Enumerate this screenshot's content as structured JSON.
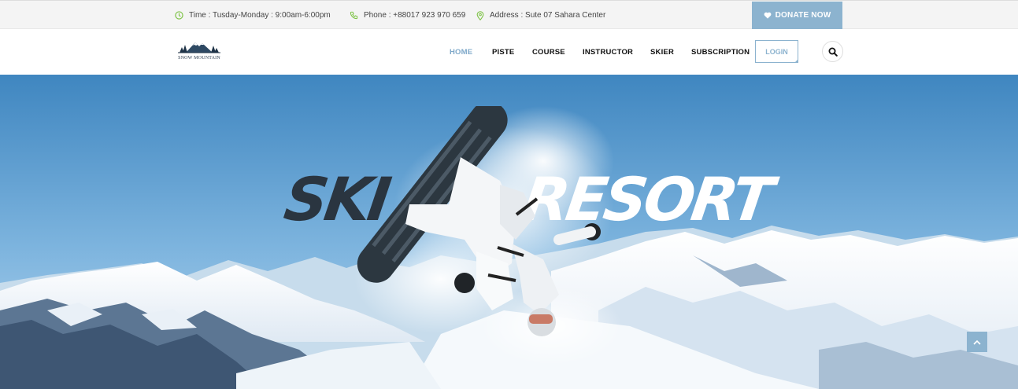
{
  "topbar": {
    "time": "Time : Tusday-Monday : 9:00am-6:00pm",
    "phone": "Phone : +88017 923 970 659",
    "address": "Address : Sute 07 Sahara Center",
    "donate_label": "DONATE NOW",
    "icons": [
      "clock-icon",
      "phone-icon",
      "map-pin-icon",
      "heart-icon"
    ],
    "icon_color": "#7cc243"
  },
  "logo": {
    "text": "SNOW MOUNTAIN"
  },
  "nav": {
    "items": [
      {
        "label": "HOME",
        "active": true
      },
      {
        "label": "PISTE"
      },
      {
        "label": "COURSE"
      },
      {
        "label": "INSTRUCTOR"
      },
      {
        "label": "SKIER"
      },
      {
        "label": "SUBSCRIPTION"
      }
    ],
    "login_label": "LOGIN",
    "accent": "#8cb3cf"
  },
  "hero": {
    "word_dark": "SKI",
    "word_light": "RESORT"
  }
}
